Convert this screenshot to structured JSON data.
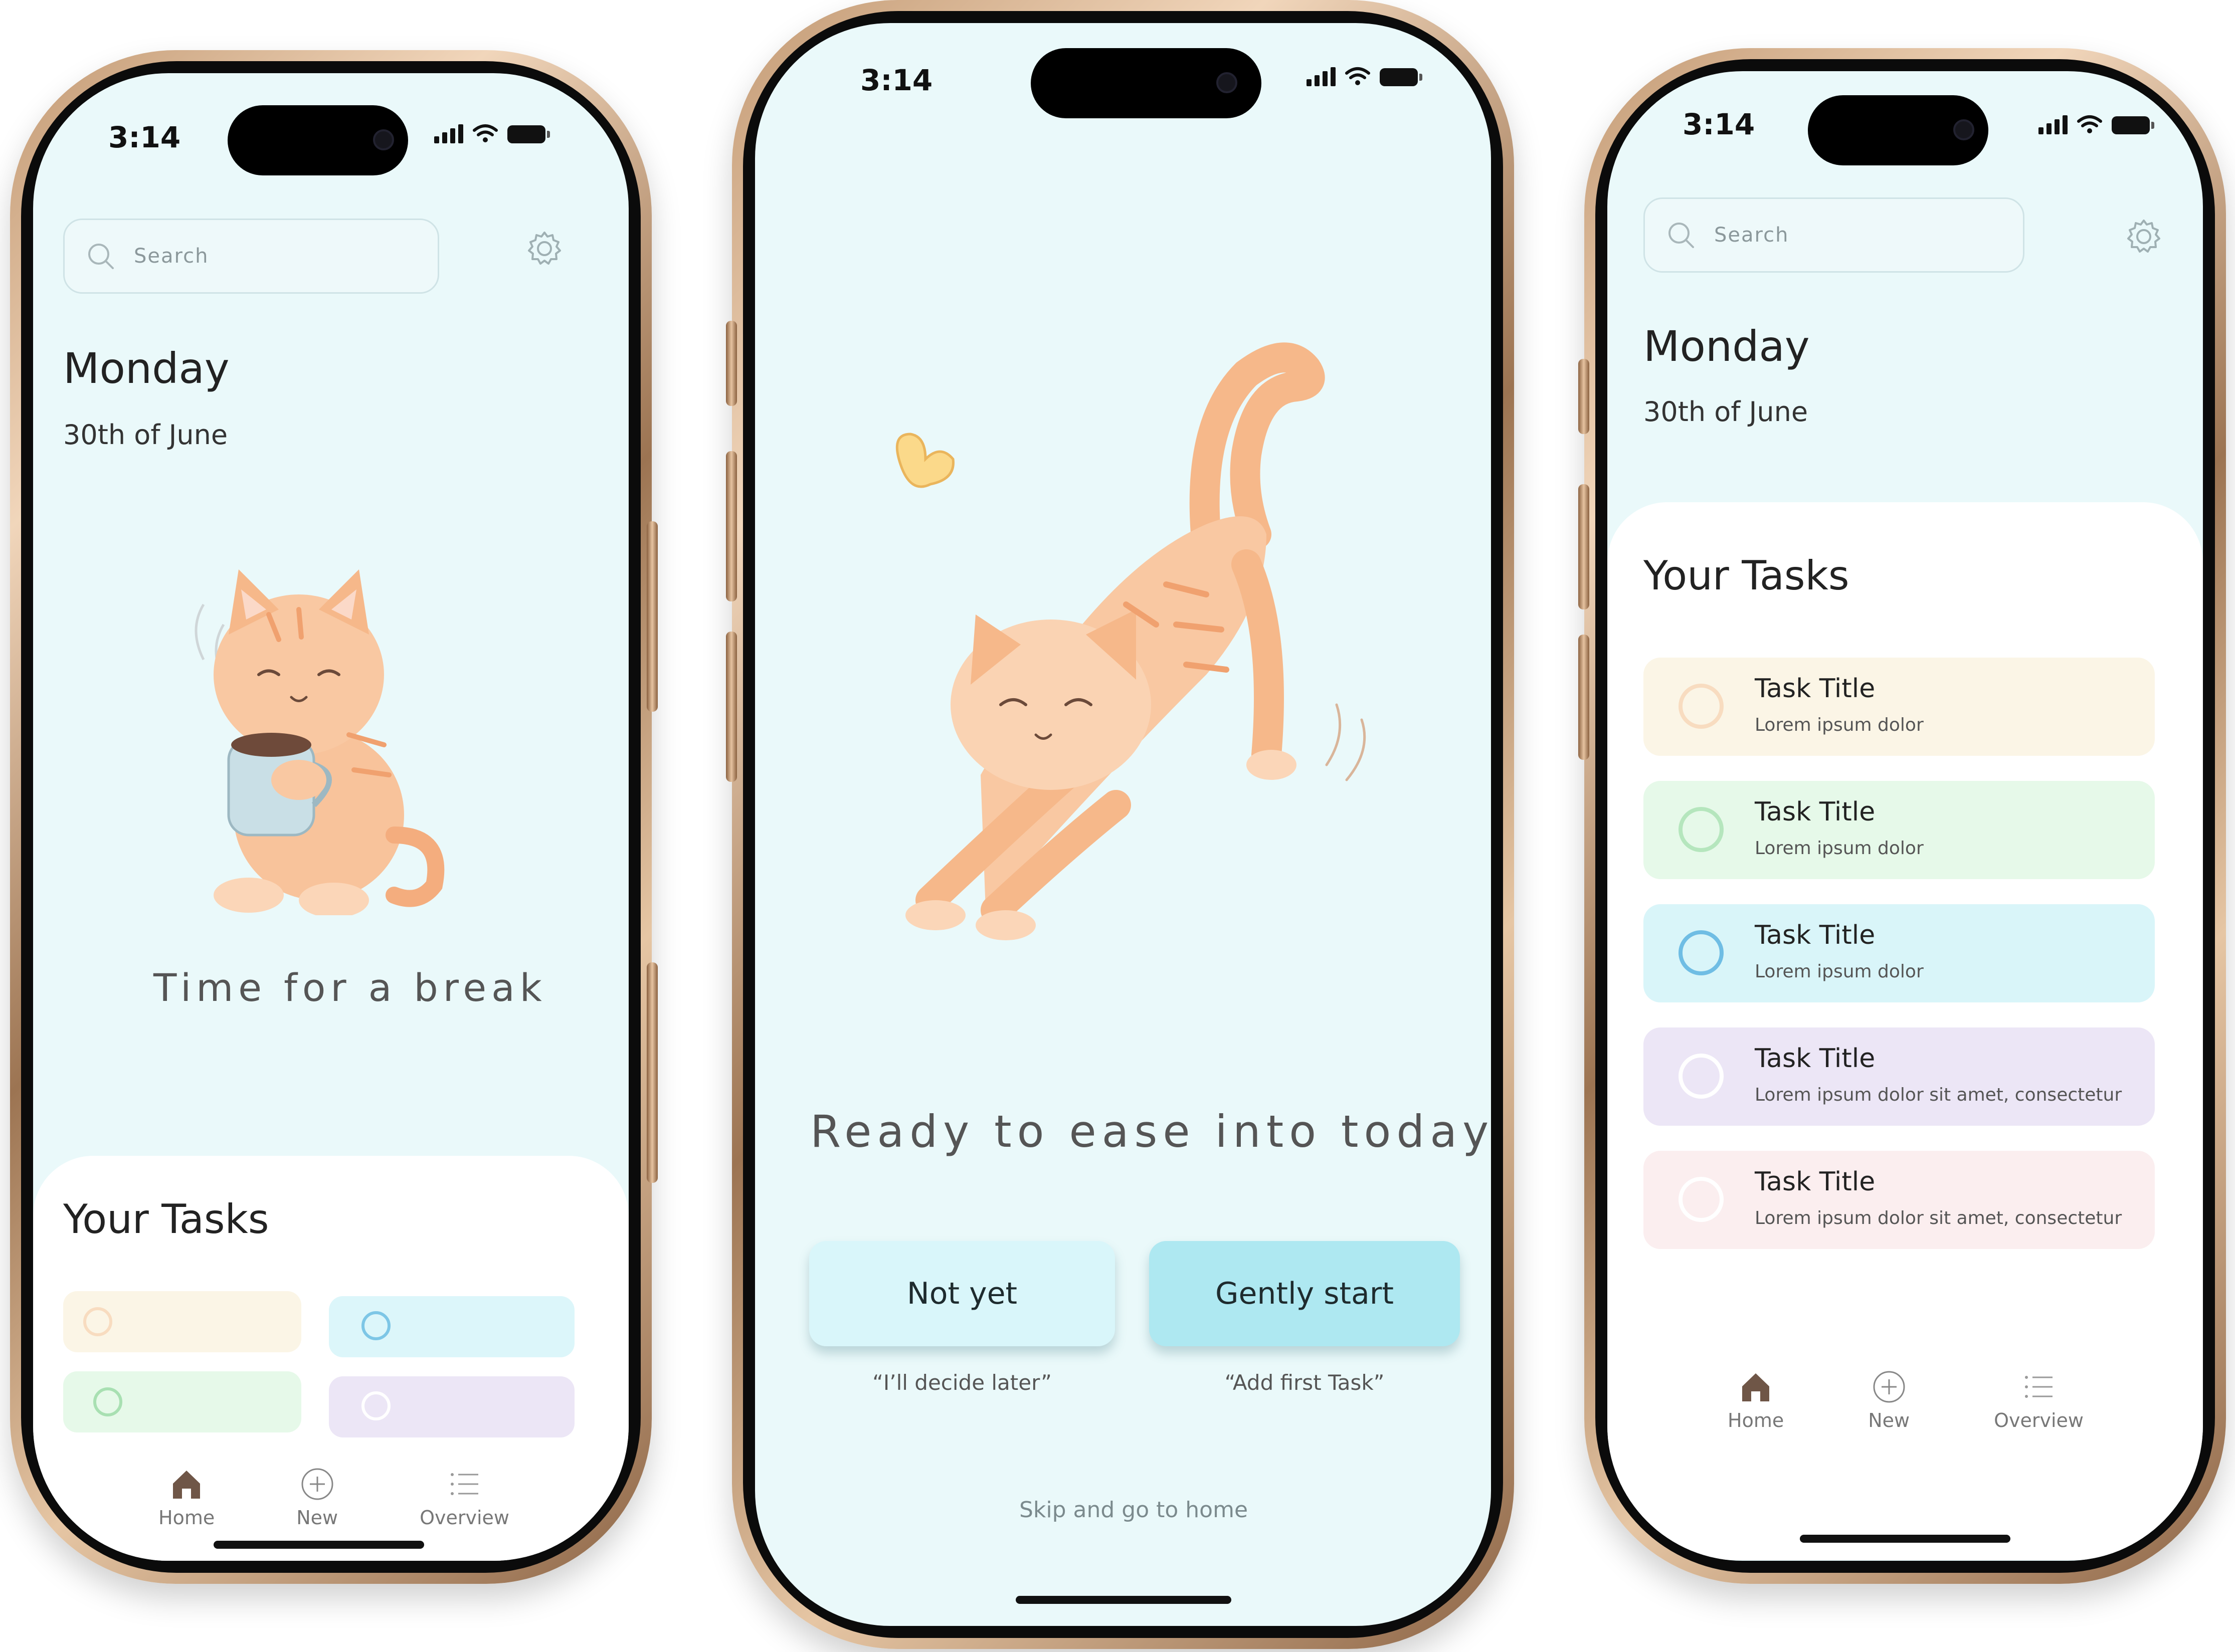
{
  "colors": {
    "screen_bg": "#eaf9fa",
    "cat_orange": "#f6b88a",
    "task_yellow": "#fbf5e6",
    "task_green": "#e6f9e9",
    "task_blue": "#d9f5f9",
    "task_purple": "#ece6f6",
    "task_pink": "#fbeeef",
    "button_light": "#d9f6fa",
    "button_accent": "#aee8f1"
  },
  "status": {
    "time": "3:14"
  },
  "left": {
    "search_placeholder": "Search",
    "day": "Monday",
    "date": "30th of June",
    "caption": "Time for a break",
    "tasks_title": "Your Tasks",
    "mini_tasks": [
      {
        "color": "#fbf5e6",
        "ring": "#f8dcc0"
      },
      {
        "color": "#dcf6fa",
        "ring": "#7dc6e6"
      },
      {
        "color": "#e6f9e9",
        "ring": "#a8e0b2"
      },
      {
        "color": "#ece6f6",
        "ring": "#ffffff"
      }
    ],
    "nav": {
      "home": "Home",
      "new": "New",
      "overview": "Overview"
    }
  },
  "center": {
    "caption": "Ready to ease into today",
    "btn_not_yet": "Not yet",
    "hint_not_yet": "“I’ll decide later”",
    "btn_start": "Gently start",
    "hint_start": "“Add first Task”",
    "skip": "Skip and go to home"
  },
  "right": {
    "search_placeholder": "Search",
    "day": "Monday",
    "date": "30th of June",
    "tasks_title": "Your Tasks",
    "tasks": [
      {
        "title": "Task Title",
        "subtitle": "Lorem ipsum dolor",
        "color": "#fbf5e6",
        "ring": "#f8dcc0"
      },
      {
        "title": "Task Title",
        "subtitle": "Lorem ipsum dolor",
        "color": "#e6f9e9",
        "ring": "#b5e6bd"
      },
      {
        "title": "Task Title",
        "subtitle": "Lorem ipsum dolor",
        "color": "#d9f5f9",
        "ring": "#6fbde4"
      },
      {
        "title": "Task Title",
        "subtitle": "Lorem ipsum dolor sit amet, consectetur",
        "color": "#ece6f6",
        "ring": "#ffffff"
      },
      {
        "title": "Task Title",
        "subtitle": "Lorem ipsum dolor sit amet, consectetur",
        "color": "#fbeeef",
        "ring": "#ffffff"
      }
    ],
    "nav": {
      "home": "Home",
      "new": "New",
      "overview": "Overview"
    }
  }
}
